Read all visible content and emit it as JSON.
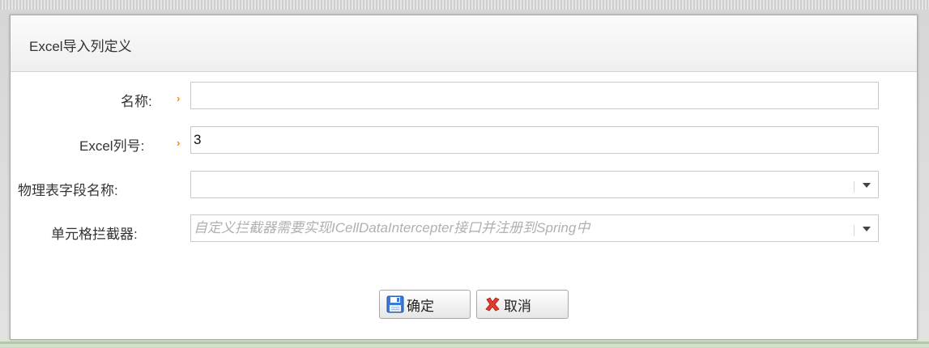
{
  "dialog": {
    "title": "Excel导入列定义"
  },
  "form": {
    "name": {
      "label": "名称:",
      "value": ""
    },
    "excel_col": {
      "label": "Excel列号:",
      "value": "3"
    },
    "field_name": {
      "label": "物理表字段名称:",
      "value": ""
    },
    "interceptor": {
      "label": "单元格拦截器:",
      "placeholder": "自定义拦截器需要实现ICellDataIntercepter接口并注册到Spring中"
    },
    "required_marker": "›"
  },
  "buttons": {
    "ok_label": "确定",
    "cancel_label": "取消"
  },
  "icons": {
    "ok": "save-disk-icon",
    "cancel": "red-x-icon",
    "dropdown": "chevron-down-icon"
  },
  "colors": {
    "required": "#f08a15",
    "save_icon": "#3a7bd5",
    "cancel_icon": "#e23b2e"
  }
}
